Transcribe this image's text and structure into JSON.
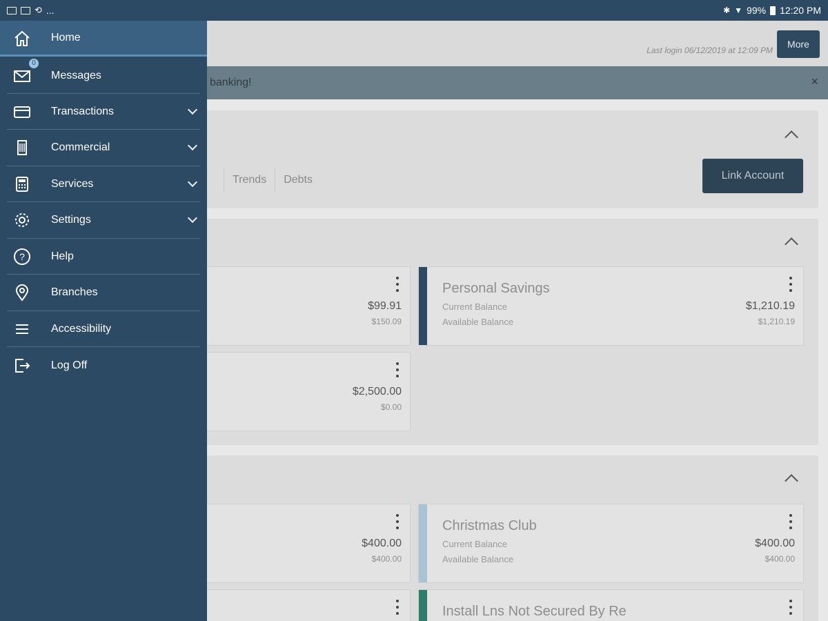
{
  "status_bar": {
    "left_extra": "...",
    "battery": "99%",
    "time": "12:20 PM"
  },
  "header": {
    "more_label": "More",
    "last_login": "Last login 06/12/2019 at 12:09 PM"
  },
  "banner": {
    "text": "banking!",
    "close_symbol": "×"
  },
  "overview_card": {
    "tabs": [
      "Trends",
      "Debts"
    ],
    "link_account_label": "Link Account"
  },
  "accounts_section_1": [
    {
      "name": "",
      "current_balance": "$99.91",
      "available_balance": "$150.09"
    },
    {
      "name": "Personal Savings",
      "current_label": "Current Balance",
      "available_label": "Available Balance",
      "current_balance": "$1,210.19",
      "available_balance": "$1,210.19",
      "color": "#2c4a63"
    },
    {
      "name": "",
      "current_balance": "$2,500.00",
      "available_balance": "$0.00"
    }
  ],
  "accounts_section_2": [
    {
      "name": "",
      "current_balance": "$400.00",
      "available_balance": "$400.00"
    },
    {
      "name": "Christmas Club",
      "current_label": "Current Balance",
      "available_label": "Available Balance",
      "current_balance": "$400.00",
      "available_balance": "$400.00",
      "color": "#a9c3d6"
    },
    {
      "name": "Install Lns Not Secured By Re",
      "color": "#2d7d6b"
    }
  ],
  "drawer": {
    "messages_badge": "0",
    "items": [
      {
        "label": "Home",
        "icon": "home-icon"
      },
      {
        "label": "Messages",
        "icon": "mail-icon"
      },
      {
        "label": "Transactions",
        "icon": "card-icon"
      },
      {
        "label": "Commercial",
        "icon": "building-icon"
      },
      {
        "label": "Services",
        "icon": "calculator-icon"
      },
      {
        "label": "Settings",
        "icon": "gear-icon"
      },
      {
        "label": "Help",
        "icon": "help-icon"
      },
      {
        "label": "Branches",
        "icon": "location-pin-icon"
      },
      {
        "label": "Accessibility",
        "icon": "menu-lines-icon"
      },
      {
        "label": "Log Off",
        "icon": "logout-icon"
      }
    ]
  },
  "colors": {
    "drawer_bg": "#2c4a63",
    "active_item_bg": "#3a6181",
    "primary_button": "#2d4356"
  }
}
